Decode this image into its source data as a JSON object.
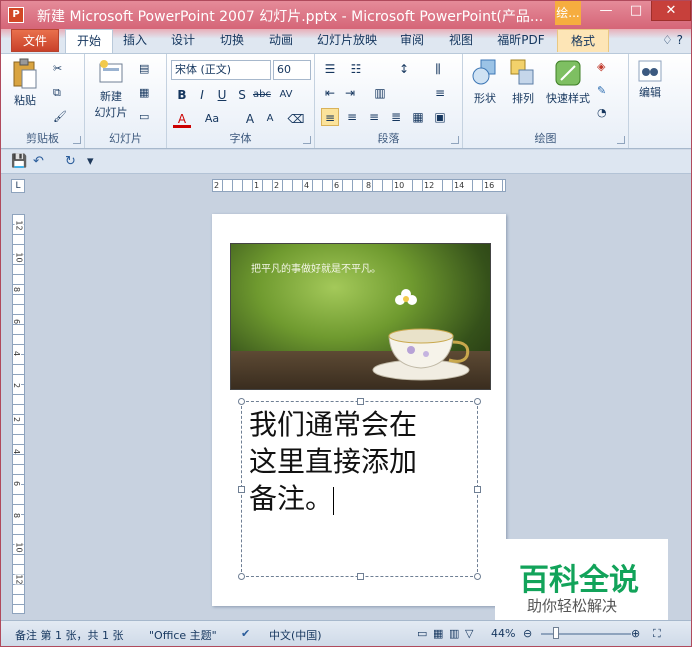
{
  "titlebar": {
    "app_icon": "P",
    "title": "新建 Microsoft PowerPoint 2007 幻灯片.pptx - Microsoft PowerPoint(产品...",
    "ctx_tab": "绘...",
    "minimize": "—",
    "maximize": "□",
    "close": "✕"
  },
  "tabs": {
    "file": "文件",
    "items": [
      "开始",
      "插入",
      "设计",
      "切换",
      "动画",
      "幻灯片放映",
      "审阅",
      "视图",
      "福昕PDF",
      "格式"
    ],
    "help": "♢ ?"
  },
  "ribbon": {
    "clipboard": {
      "paste": "粘贴",
      "label": "剪贴板"
    },
    "slides": {
      "new_slide": "新建",
      "new_slide2": "幻灯片",
      "label": "幻灯片"
    },
    "font": {
      "font_name": "宋体 (正文)",
      "font_size": "60",
      "label": "字体"
    },
    "paragraph": {
      "label": "段落"
    },
    "drawing": {
      "shapes": "形状",
      "arrange": "排列",
      "quick_styles": "快速样式",
      "label": "绘图"
    },
    "editing": {
      "edit": "编辑"
    }
  },
  "qat": {
    "save": "💾",
    "undo": "↶",
    "redo": "↻",
    "customize": "▾"
  },
  "ruler": {
    "corner": "L",
    "h_labels": [
      "2",
      "1",
      "2",
      "4",
      "6",
      "8",
      "10",
      "12",
      "14",
      "16"
    ],
    "v_labels": [
      "12",
      "10",
      "8",
      "6",
      "4",
      "2",
      "2",
      "4",
      "6",
      "8",
      "10",
      "12"
    ]
  },
  "slide": {
    "caption": "把平凡的事做好就是不平凡。",
    "notes_line1": "我们通常会在",
    "notes_line2": "这里直接添加",
    "notes_line3": "备注。"
  },
  "watermark": {
    "title": "百科全说",
    "subtitle": "助你轻松解决"
  },
  "status": {
    "page": "备注 第 1 张，共 1 张",
    "theme": "\"Office 主题\"",
    "lang": "中文(中国)",
    "zoom": "44%"
  },
  "colors": {
    "title_bar": "#d56577",
    "file_tab": "#c9412a",
    "ctx_tab": "#f6ad3f",
    "watermark_green": "#12a35a"
  }
}
